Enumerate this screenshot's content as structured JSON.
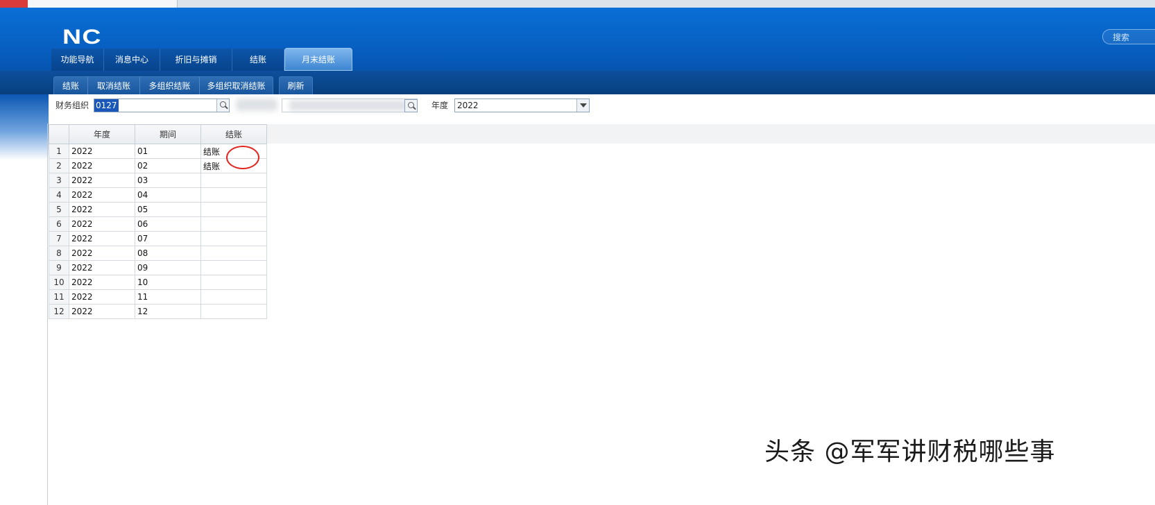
{
  "header": {
    "logo": "NC",
    "search_placeholder": "搜索"
  },
  "nav_tabs": [
    {
      "label": "功能导航"
    },
    {
      "label": "消息中心"
    },
    {
      "label": "折旧与摊销"
    },
    {
      "label": "结账"
    },
    {
      "label": "月末结账"
    }
  ],
  "toolbar": {
    "group1": [
      "结账",
      "取消结账",
      "多组织结账",
      "多组织取消结账"
    ],
    "refresh": "刷新"
  },
  "filter": {
    "org_label": "财务组织",
    "org_value": "0127",
    "year_label": "年度",
    "year_value": "2022"
  },
  "grid": {
    "columns": [
      "年度",
      "期间",
      "结账"
    ],
    "rows": [
      {
        "n": "1",
        "year": "2022",
        "period": "01",
        "closed": "结账"
      },
      {
        "n": "2",
        "year": "2022",
        "period": "02",
        "closed": "结账"
      },
      {
        "n": "3",
        "year": "2022",
        "period": "03",
        "closed": ""
      },
      {
        "n": "4",
        "year": "2022",
        "period": "04",
        "closed": ""
      },
      {
        "n": "5",
        "year": "2022",
        "period": "05",
        "closed": ""
      },
      {
        "n": "6",
        "year": "2022",
        "period": "06",
        "closed": ""
      },
      {
        "n": "7",
        "year": "2022",
        "period": "07",
        "closed": ""
      },
      {
        "n": "8",
        "year": "2022",
        "period": "08",
        "closed": ""
      },
      {
        "n": "9",
        "year": "2022",
        "period": "09",
        "closed": ""
      },
      {
        "n": "10",
        "year": "2022",
        "period": "10",
        "closed": ""
      },
      {
        "n": "11",
        "year": "2022",
        "period": "11",
        "closed": ""
      },
      {
        "n": "12",
        "year": "2022",
        "period": "12",
        "closed": ""
      }
    ]
  },
  "watermark": "头条 @军军讲财税哪些事"
}
